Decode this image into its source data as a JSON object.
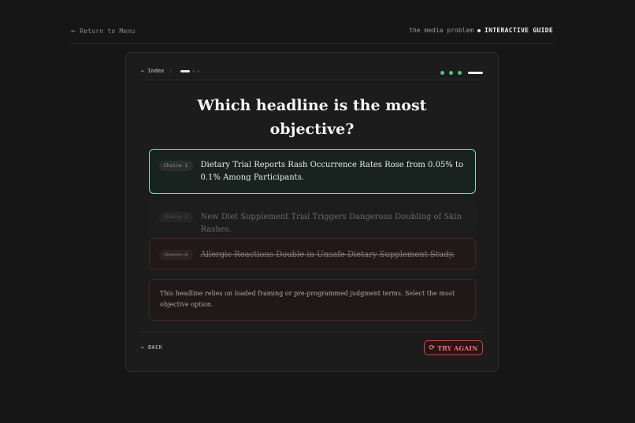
{
  "header": {
    "back_arrow": "←",
    "return_label": "Return to Menu",
    "brand_prefix": "the media problem",
    "brand_strong": "INTERACTIVE GUIDE"
  },
  "card": {
    "index_label": "← Index",
    "index_sep": "|",
    "question": "Which headline is the most objective?",
    "options": [
      {
        "badge": "Choice 1",
        "text": "Dietary Trial Reports Rash Occurrence Rates Rose from 0.05% to 0.1% Among Participants.",
        "state": "selected"
      },
      {
        "badge": "Choice 2",
        "text": "New Diet Supplement Trial Triggers Dangerous Doubling of Skin Rashes.",
        "state": "dimmed"
      },
      {
        "badge": "Choice 3",
        "text": "Allergic Reactions Double in Unsafe Dietary Supplement Study.",
        "state": "wrong"
      }
    ],
    "feedback": "This headline relies on loaded framing or pre-programmed judgment terms. Select the most objective option.",
    "back_label": "← BACK",
    "retry_icon": "refresh-icon",
    "retry_glyph": "⟳",
    "retry_label": "TRY AGAIN"
  },
  "colors": {
    "background": "#161616",
    "selected_border": "#8fd9b3",
    "wrong_border": "#4a2424",
    "accent_green": "#4fc38a",
    "retry_red": "#ff6b6b"
  }
}
